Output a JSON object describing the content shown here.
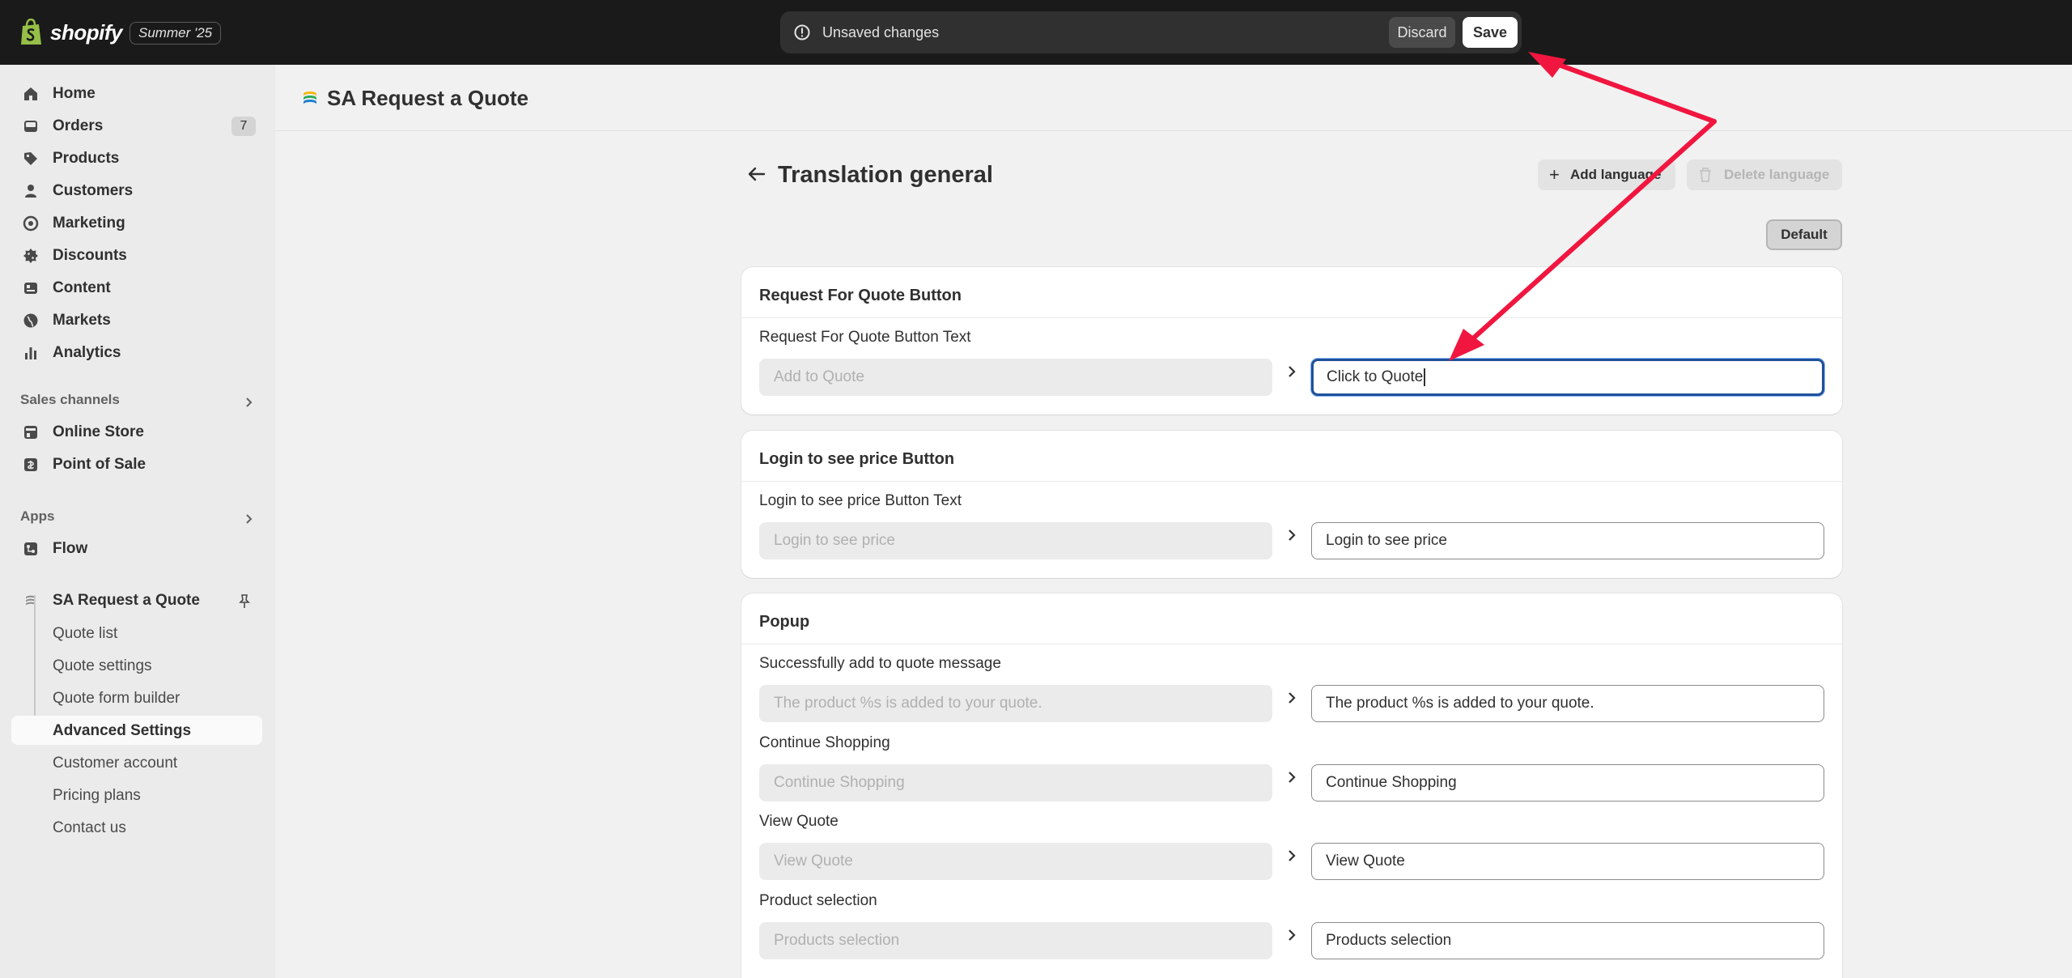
{
  "topbar": {
    "brand": "shopify",
    "edition": "Summer '25",
    "savebar": {
      "message": "Unsaved changes",
      "discard_label": "Discard",
      "save_label": "Save"
    }
  },
  "sidebar": {
    "items": [
      {
        "label": "Home",
        "icon": "home-icon"
      },
      {
        "label": "Orders",
        "icon": "orders-icon",
        "badge": "7"
      },
      {
        "label": "Products",
        "icon": "tag-icon"
      },
      {
        "label": "Customers",
        "icon": "person-icon"
      },
      {
        "label": "Marketing",
        "icon": "target-icon"
      },
      {
        "label": "Discounts",
        "icon": "discount-icon"
      },
      {
        "label": "Content",
        "icon": "content-icon"
      },
      {
        "label": "Markets",
        "icon": "globe-icon"
      },
      {
        "label": "Analytics",
        "icon": "bar-chart-icon"
      }
    ],
    "sales_channels": {
      "title": "Sales channels",
      "items": [
        {
          "label": "Online Store",
          "icon": "store-icon"
        },
        {
          "label": "Point of Sale",
          "icon": "pos-icon"
        }
      ]
    },
    "apps": {
      "title": "Apps",
      "items": [
        {
          "label": "Flow",
          "icon": "flow-icon"
        }
      ]
    },
    "app": {
      "label": "SA Request a Quote",
      "icon": "app-logo-icon",
      "sub_items": [
        {
          "label": "Quote list"
        },
        {
          "label": "Quote settings"
        },
        {
          "label": "Quote form builder"
        },
        {
          "label": "Advanced Settings",
          "active": true
        },
        {
          "label": "Customer account"
        },
        {
          "label": "Pricing plans"
        },
        {
          "label": "Contact us"
        }
      ]
    }
  },
  "app_header": {
    "title": "SA Request a Quote"
  },
  "page": {
    "title": "Translation general",
    "add_language_label": "Add language",
    "delete_language_label": "Delete language",
    "default_label": "Default"
  },
  "cards": [
    {
      "title": "Request For Quote Button",
      "fields": [
        {
          "label": "Request For Quote Button Text",
          "source": "Add to Quote",
          "value": "Click to Quote",
          "focused": true
        }
      ]
    },
    {
      "title": "Login to see price Button",
      "fields": [
        {
          "label": "Login to see price Button Text",
          "source": "Login to see price",
          "value": "Login to see price"
        }
      ]
    },
    {
      "title": "Popup",
      "fields": [
        {
          "label": "Successfully add to quote message",
          "source": "The product %s is added to your quote.",
          "value": "The product %s is added to your quote."
        },
        {
          "label": "Continue Shopping",
          "source": "Continue Shopping",
          "value": "Continue Shopping"
        },
        {
          "label": "View Quote",
          "source": "View Quote",
          "value": "View Quote"
        },
        {
          "label": "Product selection",
          "source": "Products selection",
          "value": "Products selection"
        }
      ]
    }
  ],
  "colors": {
    "topbar_bg": "#1a1a1a",
    "annotation_arrow": "#f0163f",
    "focus_border": "#1f5199"
  }
}
